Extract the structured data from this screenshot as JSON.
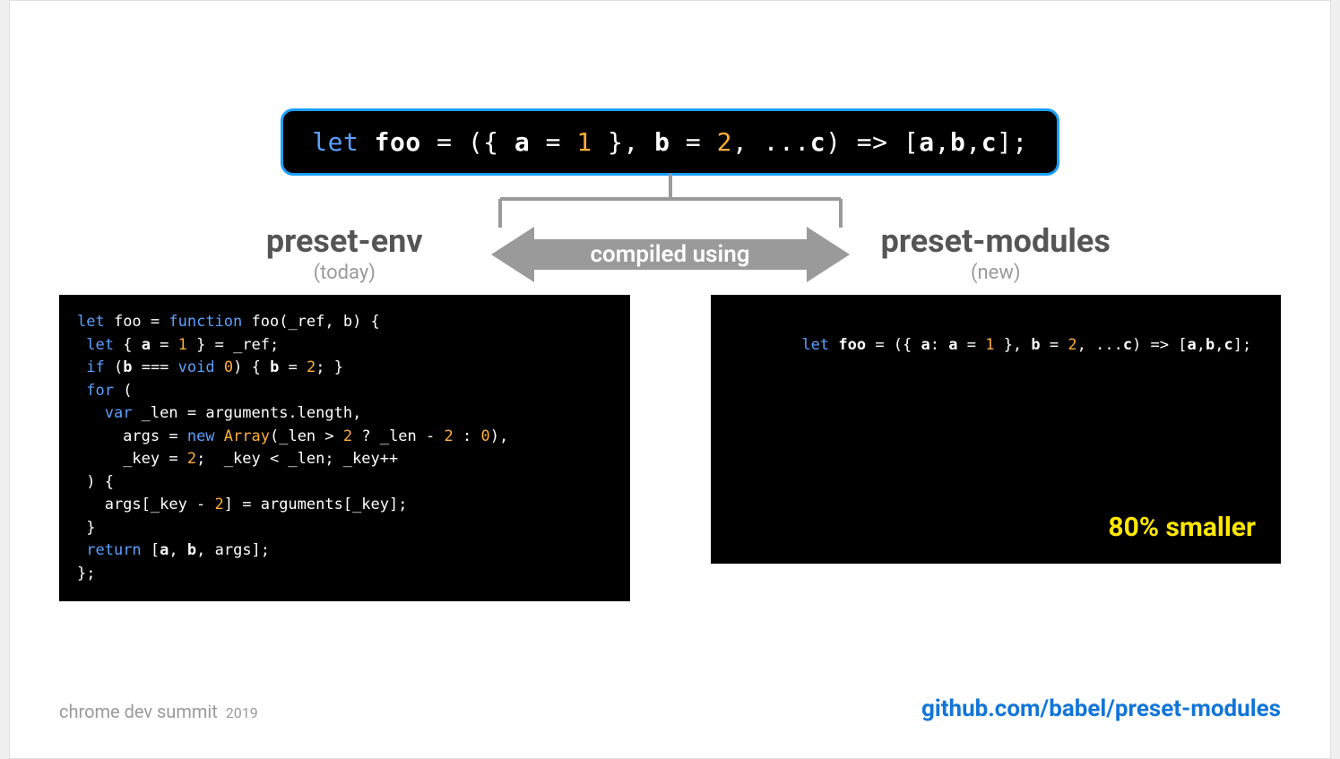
{
  "source_code_html": "<span class='k'>let</span> <span class='id'>foo</span> = ({ <span class='id'>a</span> = <span class='n'>1</span> }, <span class='id'>b</span> = <span class='n'>2</span>, ...<span class='id'>c</span>) =&gt; [<span class='id'>a</span>,<span class='id'>b</span>,<span class='id'>c</span>];",
  "arrow_label": "compiled using",
  "left": {
    "title": "preset-env",
    "subtitle": "(today)",
    "code_html": "<span class='k'>let</span> foo = <span class='k'>function</span> foo(_ref, b) {\n <span class='k'>let</span> { <span class='id'>a</span> = <span class='n'>1</span> } = _ref;\n <span class='k'>if</span> (<span class='id'>b</span> === <span class='k'>void</span> <span class='n'>0</span>) { <span class='id'>b</span> = <span class='n'>2</span>; }\n <span class='k'>for</span> (\n   <span class='k'>var</span> _len = arguments.length,\n     args = <span class='k'>new</span> <span class='fn'>Array</span>(_len &gt; <span class='n'>2</span> ? _len - <span class='n'>2</span> : <span class='n'>0</span>),\n     _key = <span class='n'>2</span>;  _key &lt; _len; _key++\n ) {\n   args[_key - <span class='n'>2</span>] = arguments[_key];\n }\n <span class='k'>return</span> [<span class='id'>a</span>, <span class='id'>b</span>, args];\n};"
  },
  "right": {
    "title": "preset-modules",
    "subtitle": "(new)",
    "code_html": "<span class='k'>let</span> <span class='id'>foo</span> = ({ <span class='id'>a</span>: <span class='id'>a</span> = <span class='n'>1</span> }, <span class='id'>b</span> = <span class='n'>2</span>, ...<span class='id'>c</span>) =&gt; [<span class='id'>a</span>,<span class='id'>b</span>,<span class='id'>c</span>];",
    "badge": "80% smaller"
  },
  "footer": {
    "event": "chrome dev summit",
    "year": "2019",
    "link": "github.com/babel/preset-modules"
  }
}
